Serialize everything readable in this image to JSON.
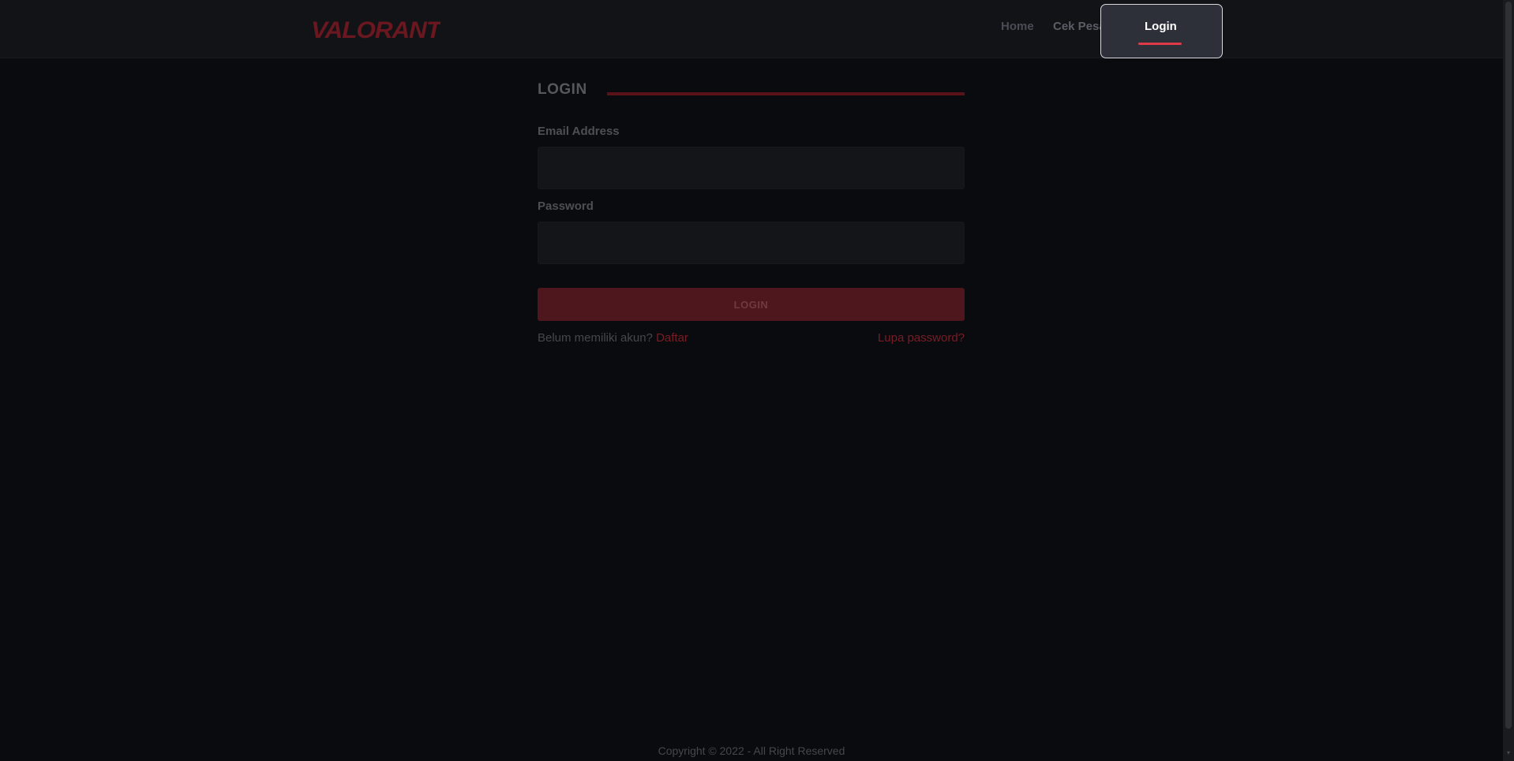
{
  "navbar": {
    "logo_text": "VALORANT",
    "links": {
      "home": "Home",
      "cek_pesanan": "Cek Pesanan",
      "login": "Login"
    }
  },
  "form": {
    "title": "LOGIN",
    "email_label": "Email Address",
    "email_value": "",
    "password_label": "Password",
    "password_value": "",
    "submit_label": "LOGIN",
    "register_prompt": "Belum memiliki akun?",
    "register_link": "Daftar",
    "forgot_link": "Lupa password?"
  },
  "footer": {
    "copyright": "Copyright © 2022 - All Right Reserved"
  },
  "colors": {
    "accent": "#e03a48",
    "accent_dim": "#7a1c26",
    "background": "#0a0b0e",
    "navbar": "#121317"
  }
}
